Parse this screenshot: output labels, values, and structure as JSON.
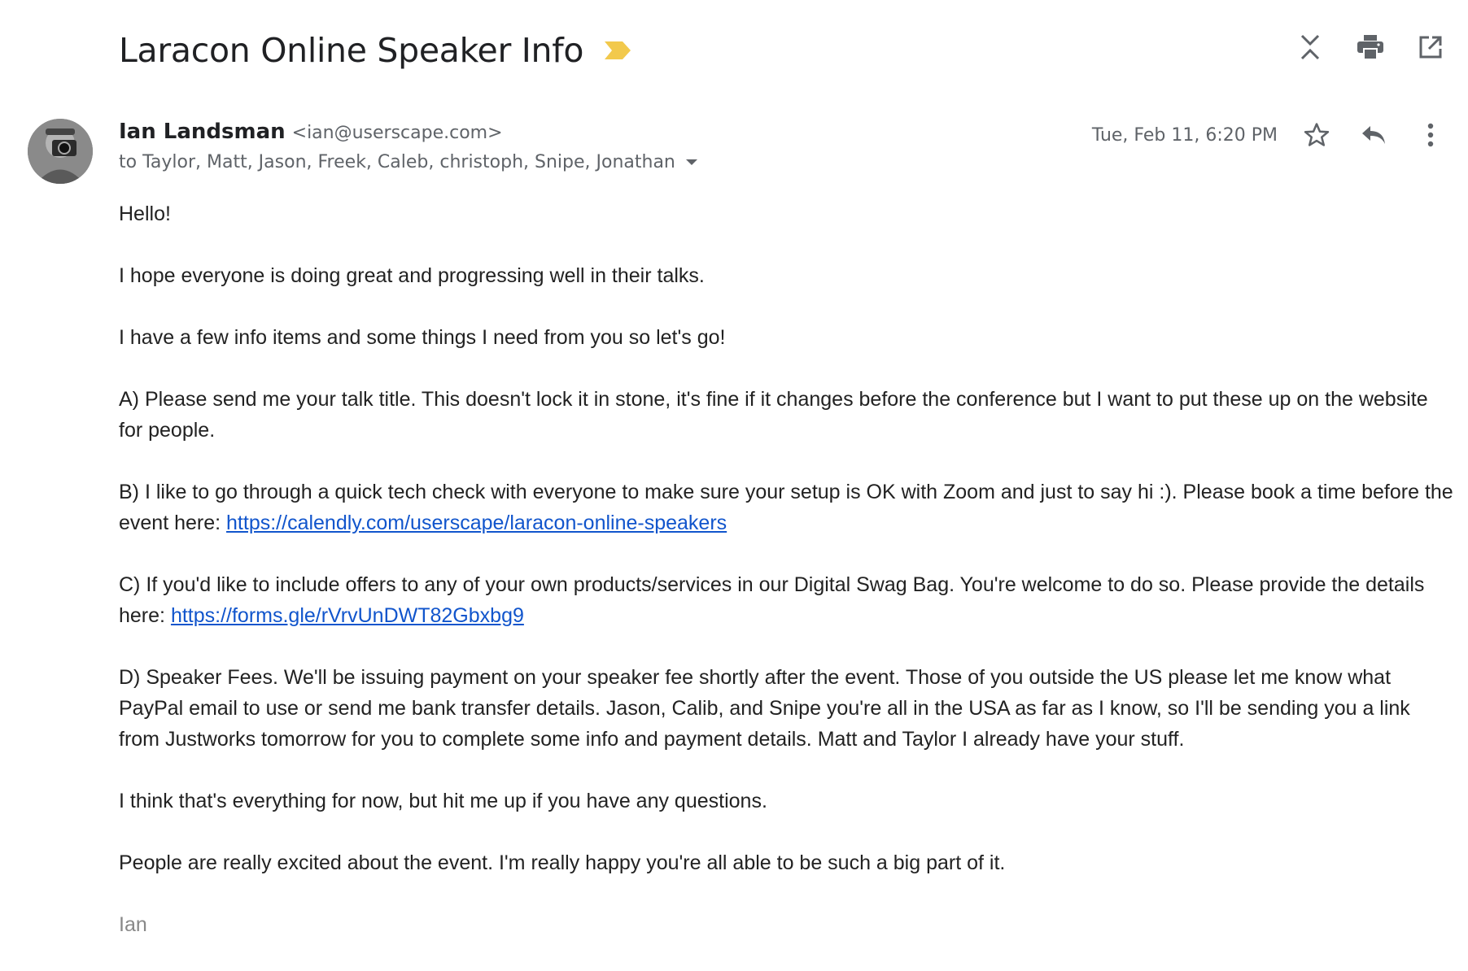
{
  "email": {
    "subject": "Laracon Online Speaker Info",
    "sender": {
      "name": "Ian Landsman",
      "email": "<ian@userscape.com>"
    },
    "recipients": "to Taylor, Matt, Jason, Freek, Caleb, christoph, Snipe, Jonathan",
    "date": "Tue, Feb 11, 6:20 PM",
    "body": {
      "greeting": "Hello!",
      "p1": "I hope everyone is doing great and progressing well in their talks.",
      "p2": "I have a few info items and some things I need from you so let's go!",
      "pA": "A) Please send me your talk title. This doesn't lock it in stone, it's fine if it changes before the conference but I want to put these up on the website for people.",
      "pB_text": "B) I like to go through a quick tech check with everyone to make sure your setup is OK with Zoom and just to say hi :). Please book a time before the event here: ",
      "pB_link": "https://calendly.com/userscape/laracon-online-speakers",
      "pC_text": "C) If you'd like to include offers to any of your own products/services in our Digital Swag Bag. You're welcome to do so. Please provide the details here: ",
      "pC_link": "https://forms.gle/rVrvUnDWT82Gbxbg9",
      "pD": "D) Speaker Fees. We'll be issuing payment on your speaker fee shortly after the event. Those of you outside the US please let me know what PayPal email to use or send me bank transfer details. Jason, Calib, and Snipe you're all in the USA as far as I know, so I'll be sending you a link from Justworks tomorrow for you to complete some info and payment details. Matt and Taylor I already have your stuff.",
      "p3": "I think that's everything for now, but hit me up if you have any questions.",
      "p4": "People are really excited about the event. I'm really happy you're all able to be such a big part of it.",
      "signature": "Ian"
    }
  },
  "icons": {
    "label": "important-marker-icon",
    "collapse": "collapse-all-icon",
    "print": "print-icon",
    "open_new": "open-in-new-window-icon",
    "star": "star-icon",
    "reply": "reply-icon",
    "more": "more-vert-icon",
    "dropdown": "dropdown-arrow-icon"
  },
  "colors": {
    "label_marker": "#f2c94c",
    "link": "#1155cc",
    "muted": "#5f6368",
    "signature": "#888888"
  }
}
